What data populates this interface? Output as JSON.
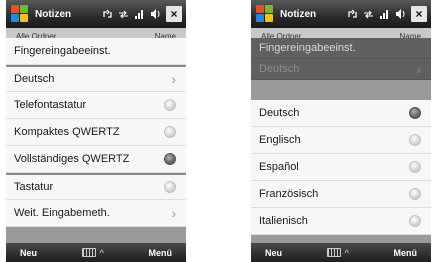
{
  "left": {
    "title": "Notizen",
    "subbar_left": "Alle Ordner",
    "subbar_right": "Name",
    "menu": [
      {
        "label": "Fingereingabeeinst.",
        "control": "none"
      },
      {
        "label": "Deutsch",
        "control": "chevron"
      },
      {
        "label": "Telefontastatur",
        "control": "radio",
        "selected": false
      },
      {
        "label": "Kompaktes QWERTZ",
        "control": "radio",
        "selected": false
      },
      {
        "label": "Vollständiges QWERTZ",
        "control": "radio",
        "selected": true
      },
      {
        "label": "Tastatur",
        "control": "radio",
        "selected": false
      },
      {
        "label": "Weit. Eingabemeth.",
        "control": "chevron"
      }
    ],
    "softkeys": {
      "left": "Neu",
      "right": "Menü"
    }
  },
  "right": {
    "title": "Notizen",
    "subbar_left": "Alle Ordner",
    "subbar_right": "Name",
    "dimmed": [
      {
        "label": "Fingereingabeeinst."
      },
      {
        "label": "Deutsch"
      }
    ],
    "languages": [
      {
        "label": "Deutsch",
        "selected": true
      },
      {
        "label": "Englisch",
        "selected": false
      },
      {
        "label": "Español",
        "selected": false
      },
      {
        "label": "Französisch",
        "selected": false
      },
      {
        "label": "Italienisch",
        "selected": false
      }
    ],
    "softkeys": {
      "left": "Neu",
      "right": "Menü"
    }
  },
  "icons": {
    "close": "×",
    "chevron": "›",
    "kbd_arrow": "^",
    "sync_icon": "sync-icon",
    "signal_icon": "signal-icon",
    "volume_icon": "volume-icon"
  }
}
